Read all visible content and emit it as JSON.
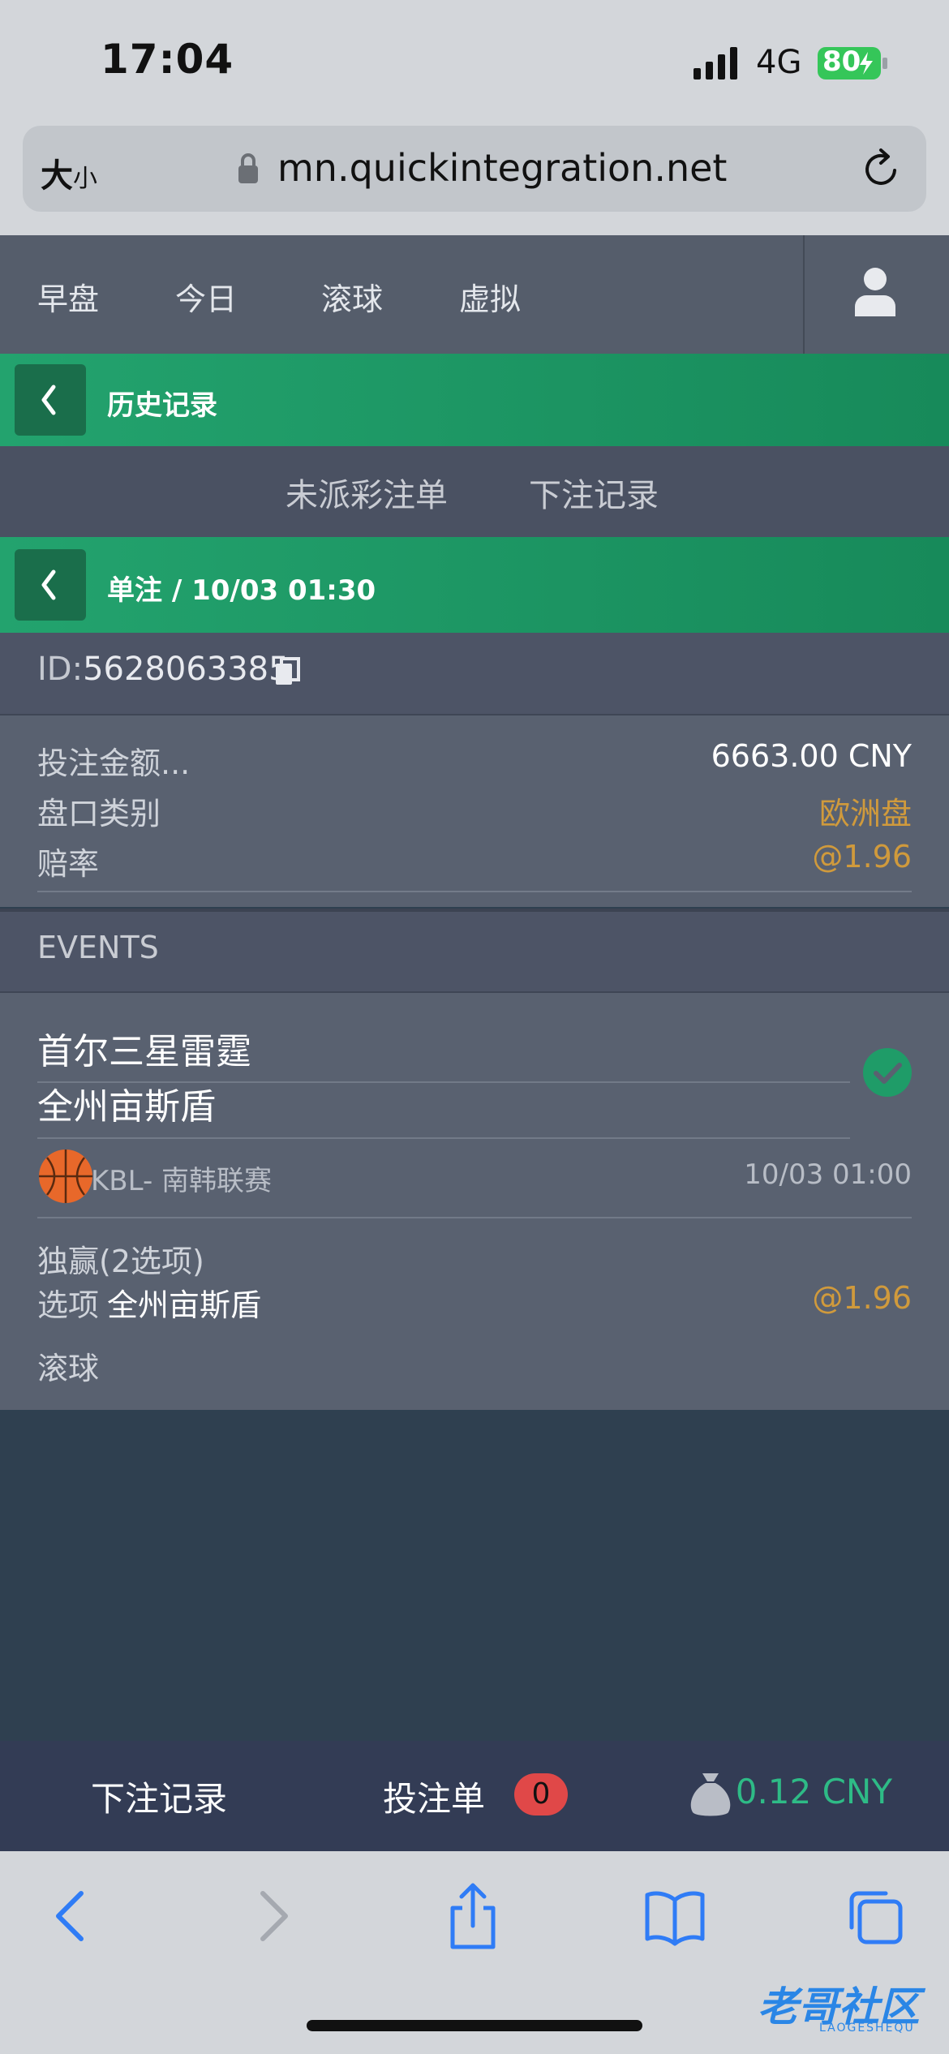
{
  "status_bar": {
    "time": "17:04",
    "network": "4G",
    "battery": "80"
  },
  "browser": {
    "text_size_big": "大",
    "text_size_small": "小",
    "url": "mn.quickintegration.net"
  },
  "top_nav": {
    "tabs": [
      "早盘",
      "今日",
      "滚球",
      "虚拟"
    ]
  },
  "history_bar": {
    "title": "历史记录"
  },
  "sub_tabs": [
    "未派彩注单",
    "下注记录"
  ],
  "detail_bar": {
    "title": "单注 / 10/03 01:30"
  },
  "bet": {
    "id_label": "ID:",
    "id_value": "5628063385",
    "rows": [
      {
        "label": "投注金额...",
        "value": "6663.00 CNY",
        "color": "#ffffff"
      },
      {
        "label": "盘口类别",
        "value": "欧洲盘",
        "color": "#d09a3c"
      },
      {
        "label": "赔率",
        "value": "@1.96",
        "color": "#d09a3c"
      }
    ]
  },
  "events": {
    "header": "EVENTS",
    "home_team": "首尔三星雷霆",
    "away_team": "全州亩斯盾",
    "league": "KBL- 南韩联赛",
    "event_time": "10/03 01:00",
    "market": "独赢(2选项)",
    "selection_label": "选项",
    "selection_value": "全州亩斯盾",
    "selection_odds": "@1.96",
    "live_label": "滚球",
    "status_icon": "check-circle-icon"
  },
  "bottom_bar": {
    "records_label": "下注记录",
    "slip_label": "投注单",
    "slip_count": "0",
    "balance": "0.12 CNY"
  },
  "watermark": {
    "text": "老哥社区",
    "sub": "LAOGESHEQU"
  },
  "colors": {
    "accent_green": "#1f9c68",
    "odds_orange": "#d09a3c",
    "balance_green": "#2ebb86",
    "badge_red": "#e04848",
    "safari_blue": "#2f7cf6"
  }
}
